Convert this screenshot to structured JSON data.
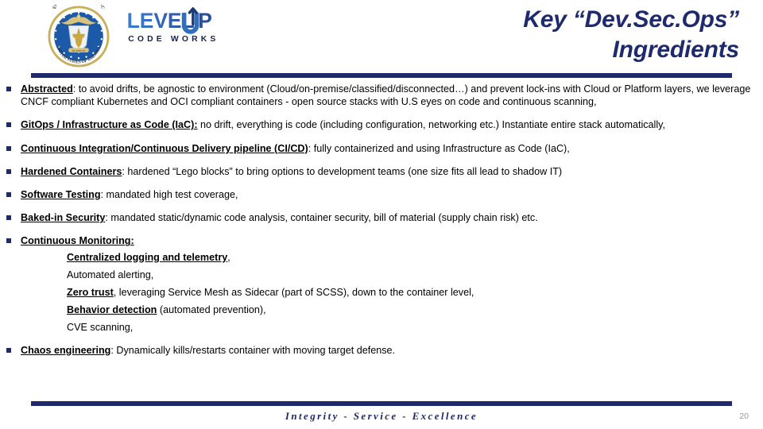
{
  "header": {
    "title_line1": "Key “Dev.Sec.Ops”",
    "title_line2": "Ingredients",
    "seal_alt": "Department of the Air Force Seal",
    "logo_word": "LEVELUP",
    "logo_sub": "C O D E   W O R K S",
    "rule_color": "#1f2a6e"
  },
  "bullets": [
    {
      "lead": "Abstracted",
      "rest": ": to avoid drifts, be agnostic to environment (Cloud/on-premise/classified/disconnected…) and prevent lock-ins with Cloud or Platform layers, we leverage CNCF compliant Kubernetes and OCI compliant containers - open source stacks with U.S eyes on code and continuous scanning,"
    },
    {
      "lead": "GitOps / Infrastructure as Code (IaC):",
      "rest": " no drift, everything is code (including configuration, networking etc.) Instantiate entire stack automatically,"
    },
    {
      "lead": "Continuous Integration/Continuous Delivery pipeline (CI/CD)",
      "rest": ": fully containerized and using Infrastructure as Code (IaC),"
    },
    {
      "lead": "Hardened Containers",
      "rest": ": hardened “Lego blocks” to bring options to development teams (one size fits all lead to shadow IT)"
    },
    {
      "lead": "Software Testing",
      "rest": ": mandated high test coverage,"
    },
    {
      "lead": "Baked-in Security",
      "rest": ": mandated static/dynamic code analysis, container security, bill of material (supply chain risk) etc."
    },
    {
      "lead": "Continuous Monitoring:",
      "rest": "",
      "subbullets": [
        {
          "lead": "Centralized logging and telemetry",
          "rest": ","
        },
        {
          "lead": "",
          "rest": "Automated alerting,"
        },
        {
          "lead": "Zero trust",
          "rest": ", leveraging Service Mesh as Sidecar (part of SCSS), down to the container level,"
        },
        {
          "lead": "Behavior detection",
          "rest": " (automated prevention),"
        },
        {
          "lead": "",
          "rest": "CVE scanning,"
        }
      ]
    },
    {
      "lead": "Chaos engineering",
      "rest": ": Dynamically kills/restarts container with moving target defense."
    }
  ],
  "footer": {
    "tagline": "Integrity - Service - Excellence",
    "page_number": "20"
  }
}
